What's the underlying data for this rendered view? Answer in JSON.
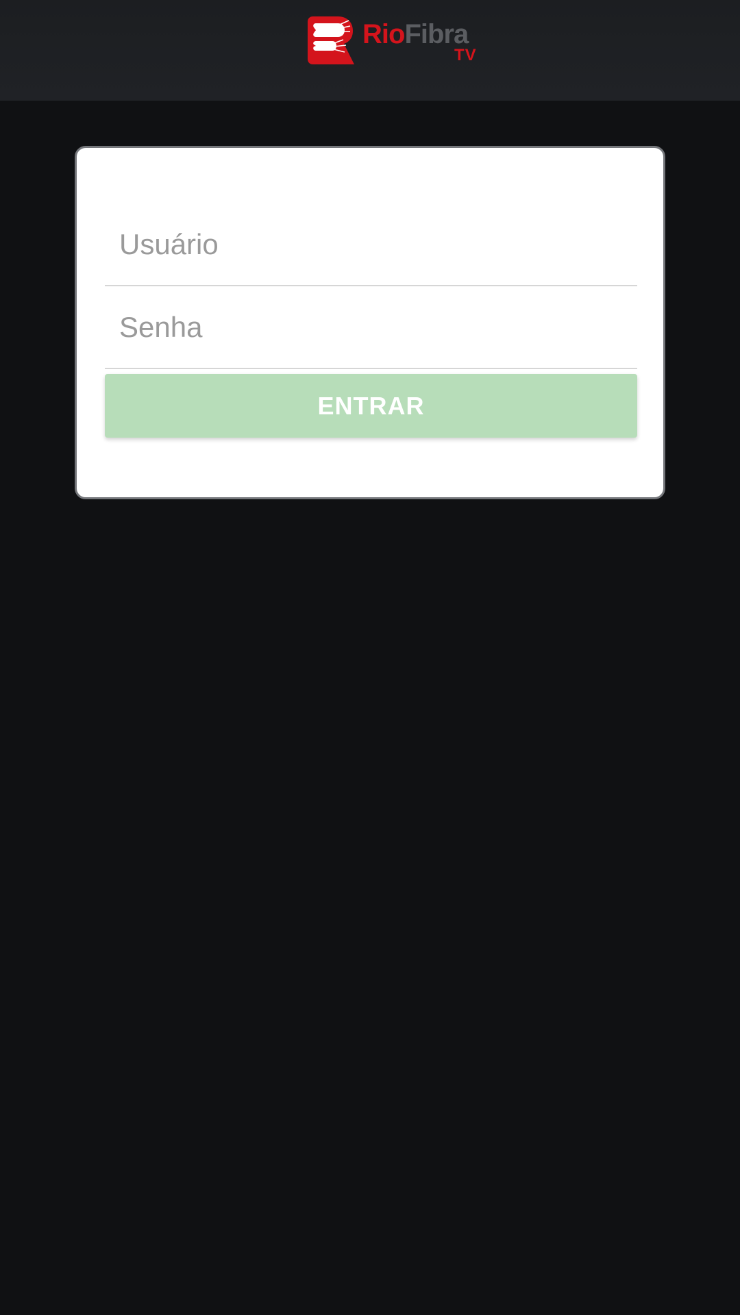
{
  "header": {
    "logo": {
      "brand_primary": "Rio",
      "brand_secondary": "Fibra",
      "brand_suffix": "TV"
    }
  },
  "login": {
    "username": {
      "value": "",
      "placeholder": "Usuário"
    },
    "password": {
      "value": "",
      "placeholder": "Senha"
    },
    "submit_label": "ENTRAR"
  },
  "colors": {
    "background": "#101113",
    "header": "#1f2124",
    "brand_red": "#d4141c",
    "brand_gray": "#5b5d61",
    "button_disabled_green": "#b7ddb9"
  }
}
